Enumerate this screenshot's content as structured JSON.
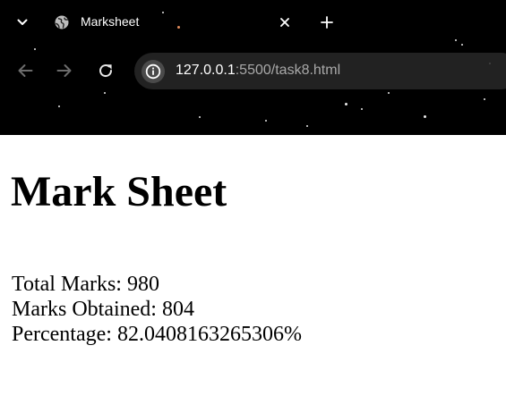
{
  "browser": {
    "tab": {
      "title": "Marksheet",
      "favicon": "globe-icon"
    },
    "icons": {
      "tab_search": "chevron-down-icon",
      "close": "close-icon",
      "new_tab": "plus-icon",
      "back": "back-arrow-icon",
      "forward": "forward-arrow-icon",
      "reload": "reload-icon",
      "site_info": "info-icon"
    },
    "address_bar": {
      "host": "127.0.0.1",
      "rest": ":5500/task8.html"
    },
    "colors": {
      "chrome_background": "#000000",
      "url_host": "#ffffff",
      "url_rest": "#a8a8a8"
    }
  },
  "page": {
    "title": "Mark Sheet",
    "results": [
      "Total Marks: 980",
      "Marks Obtained: 804",
      "Percentage: 82.0408163265306%"
    ]
  }
}
